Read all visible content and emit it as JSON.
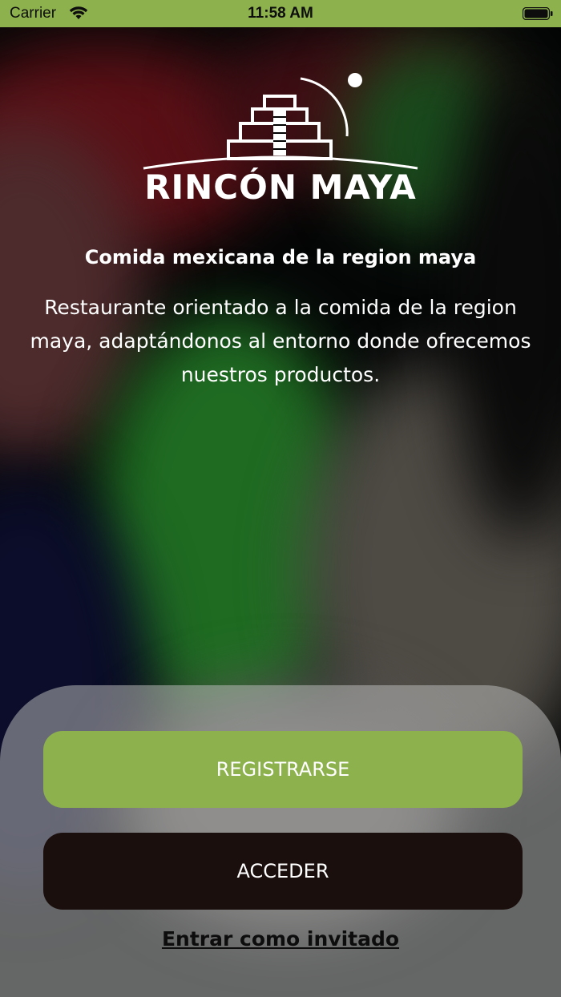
{
  "status_bar": {
    "carrier": "Carrier",
    "time": "11:58 AM"
  },
  "brand": {
    "name": "RINCÓN MAYA"
  },
  "hero": {
    "tagline": "Comida mexicana de la region maya",
    "description": "Restaurante orientado a la comida de la region maya, adaptándonos al entorno donde ofrecemos nuestros productos."
  },
  "actions": {
    "register_label": "REGISTRARSE",
    "login_label": "ACCEDER",
    "guest_label": "Entrar como invitado"
  },
  "colors": {
    "accent_green": "#8db14c",
    "dark_button": "#1b0f0d"
  }
}
